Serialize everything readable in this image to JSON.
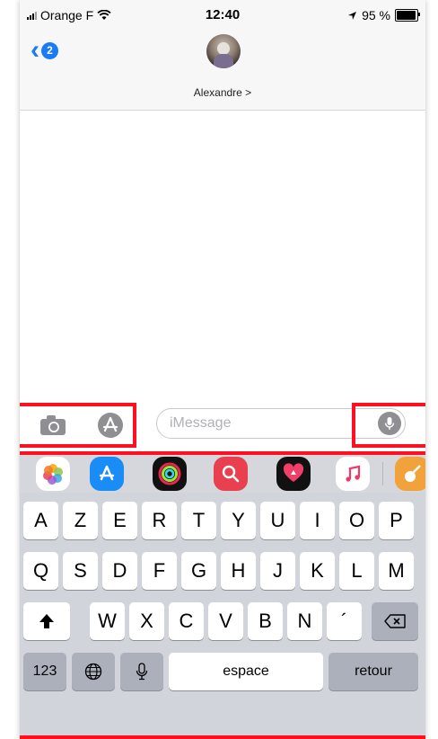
{
  "status": {
    "carrier": "Orange F",
    "time": "12:40",
    "battery_percent": "95 %",
    "battery_level": 0.95
  },
  "nav": {
    "back_badge": "2",
    "contact_name": "Alexandre >"
  },
  "input": {
    "placeholder": "iMessage"
  },
  "apps": [
    "photos",
    "app-store",
    "activity",
    "search-images",
    "digital-touch",
    "music",
    "garageband"
  ],
  "keyboard": {
    "row1": [
      "A",
      "Z",
      "E",
      "R",
      "T",
      "Y",
      "U",
      "I",
      "O",
      "P"
    ],
    "row2": [
      "Q",
      "S",
      "D",
      "F",
      "G",
      "H",
      "J",
      "K",
      "L",
      "M"
    ],
    "row3": [
      "W",
      "X",
      "C",
      "V",
      "B",
      "N",
      "´"
    ],
    "numbers": "123",
    "space": "espace",
    "return": "retour"
  },
  "colors": {
    "accent": "#1a7cf5",
    "highlight": "#ff0f1f"
  }
}
